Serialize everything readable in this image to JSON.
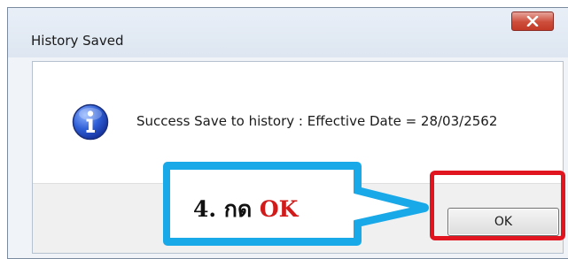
{
  "dialog": {
    "title": "History Saved",
    "message": "Success Save to history : Effective Date = 28/03/2562",
    "ok_label": "OK",
    "close_glyph": "x",
    "icon": "info-icon"
  },
  "annotation": {
    "step_text": "4. กด",
    "ok_text": "OK",
    "highlight_color": "#e01520",
    "callout_color": "#1aa9e8"
  }
}
